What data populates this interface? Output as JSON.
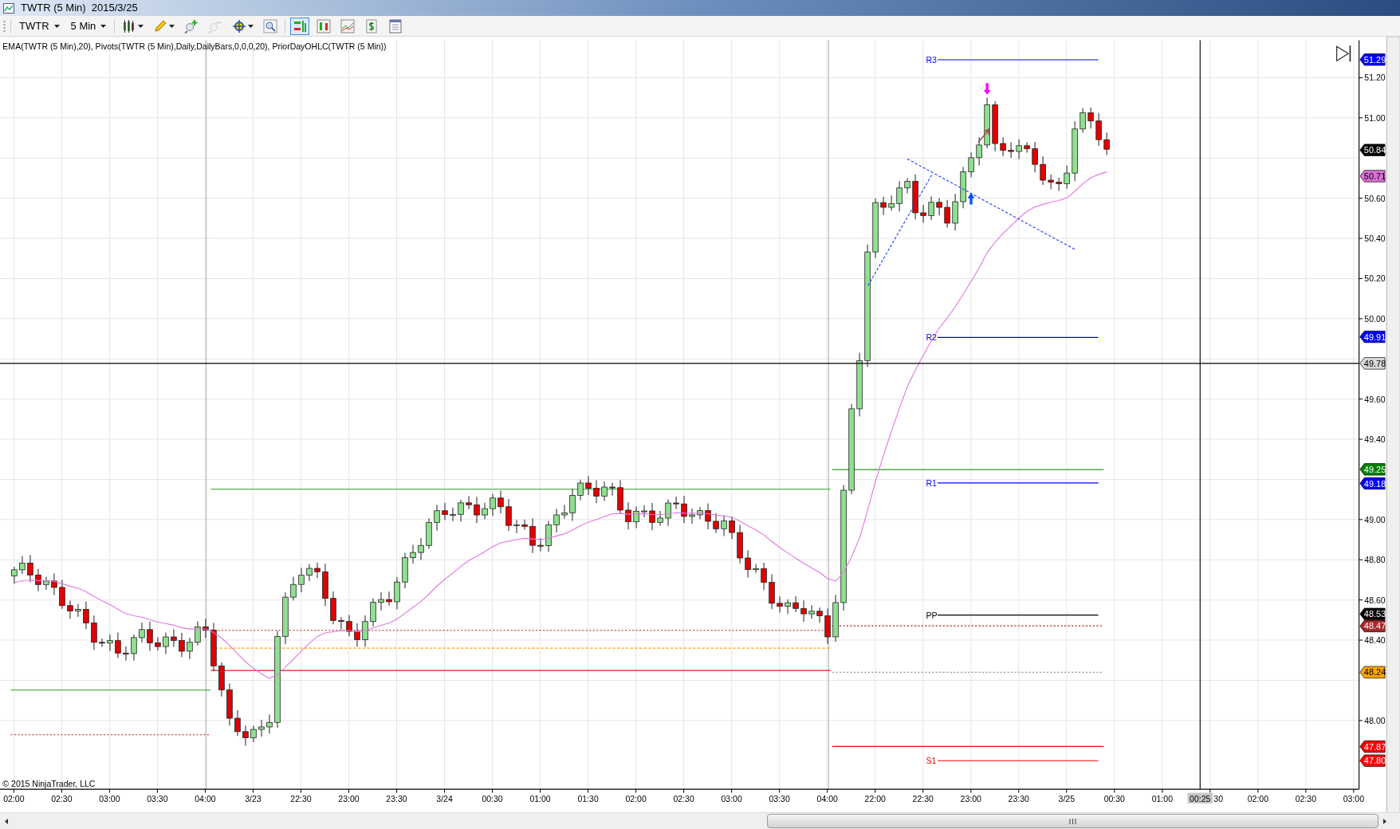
{
  "window": {
    "title": "TWTR (5 Min)  2015/3/25"
  },
  "toolbar": {
    "instrument": "TWTR",
    "interval": "5 Min",
    "tools": [
      {
        "kind": "candles",
        "selected": false,
        "disabled": false
      },
      {
        "kind": "pencil",
        "selected": false,
        "disabled": false
      },
      {
        "kind": "zoom-in",
        "selected": false,
        "disabled": false
      },
      {
        "kind": "zoom-out",
        "selected": false,
        "disabled": true
      },
      {
        "kind": "crosshair",
        "selected": false,
        "disabled": false
      },
      {
        "kind": "magnifier",
        "selected": false,
        "disabled": false
      },
      {
        "kind": "trader",
        "selected": true,
        "disabled": false
      },
      {
        "kind": "bars",
        "selected": false,
        "disabled": false
      },
      {
        "kind": "lines",
        "selected": false,
        "disabled": false
      },
      {
        "kind": "dollar",
        "selected": false,
        "disabled": false
      },
      {
        "kind": "properties",
        "selected": false,
        "disabled": false
      }
    ]
  },
  "chart": {
    "indicators": "EMA(TWTR (5 Min),20), Pivots(TWTR (5 Min),Daily,DailyBars,0,0,0,20), PriorDayOHLC(TWTR (5 Min))",
    "copyright": "© 2015 NinjaTrader, LLC",
    "pivots": [
      {
        "label": "R3",
        "color": "#0000ff"
      },
      {
        "label": "R2",
        "color": "#0000ff"
      },
      {
        "label": "R1",
        "color": "#0000ff"
      },
      {
        "label": "PP",
        "color": "#000000"
      },
      {
        "label": "S1",
        "color": "#ff0000"
      }
    ],
    "price_ticks": [
      "51.20",
      "51.00",
      "50.60",
      "50.40",
      "50.20",
      "50.00",
      "49.60",
      "49.40",
      "49.00",
      "48.80",
      "48.60",
      "48.40",
      "48.00"
    ],
    "price_tags": [
      {
        "text": "51.29",
        "color": "#0000ff"
      },
      {
        "text": "50.84",
        "color": "#000000"
      },
      {
        "text": "50.71",
        "color": "#da70d6"
      },
      {
        "text": "49.91",
        "color": "#0000ff"
      },
      {
        "text": "49.25",
        "color": "#008000"
      },
      {
        "text": "49.18",
        "color": "#0000ff"
      },
      {
        "text": "48.53",
        "color": "#000000"
      },
      {
        "text": "48.47",
        "color": "#a52a2a"
      },
      {
        "text": "48.24",
        "color": "#ffa500"
      },
      {
        "text": "47.87",
        "color": "#ff0000"
      },
      {
        "text": "47.80",
        "color": "#ff0000"
      }
    ],
    "time_ticks": [
      "02:00",
      "02:30",
      "03:00",
      "03:30",
      "04:00",
      "3/23",
      "22:30",
      "23:00",
      "23:30",
      "3/24",
      "00:30",
      "01:00",
      "01:30",
      "02:00",
      "02:30",
      "03:00",
      "03:30",
      "04:00",
      "22:00",
      "22:30",
      "23:00",
      "23:30",
      "3/25",
      "00:30",
      "01:00",
      "30",
      "02:00",
      "02:30",
      "03:00"
    ],
    "crosshair": {
      "time": "00:25",
      "price": "49.78"
    }
  }
}
